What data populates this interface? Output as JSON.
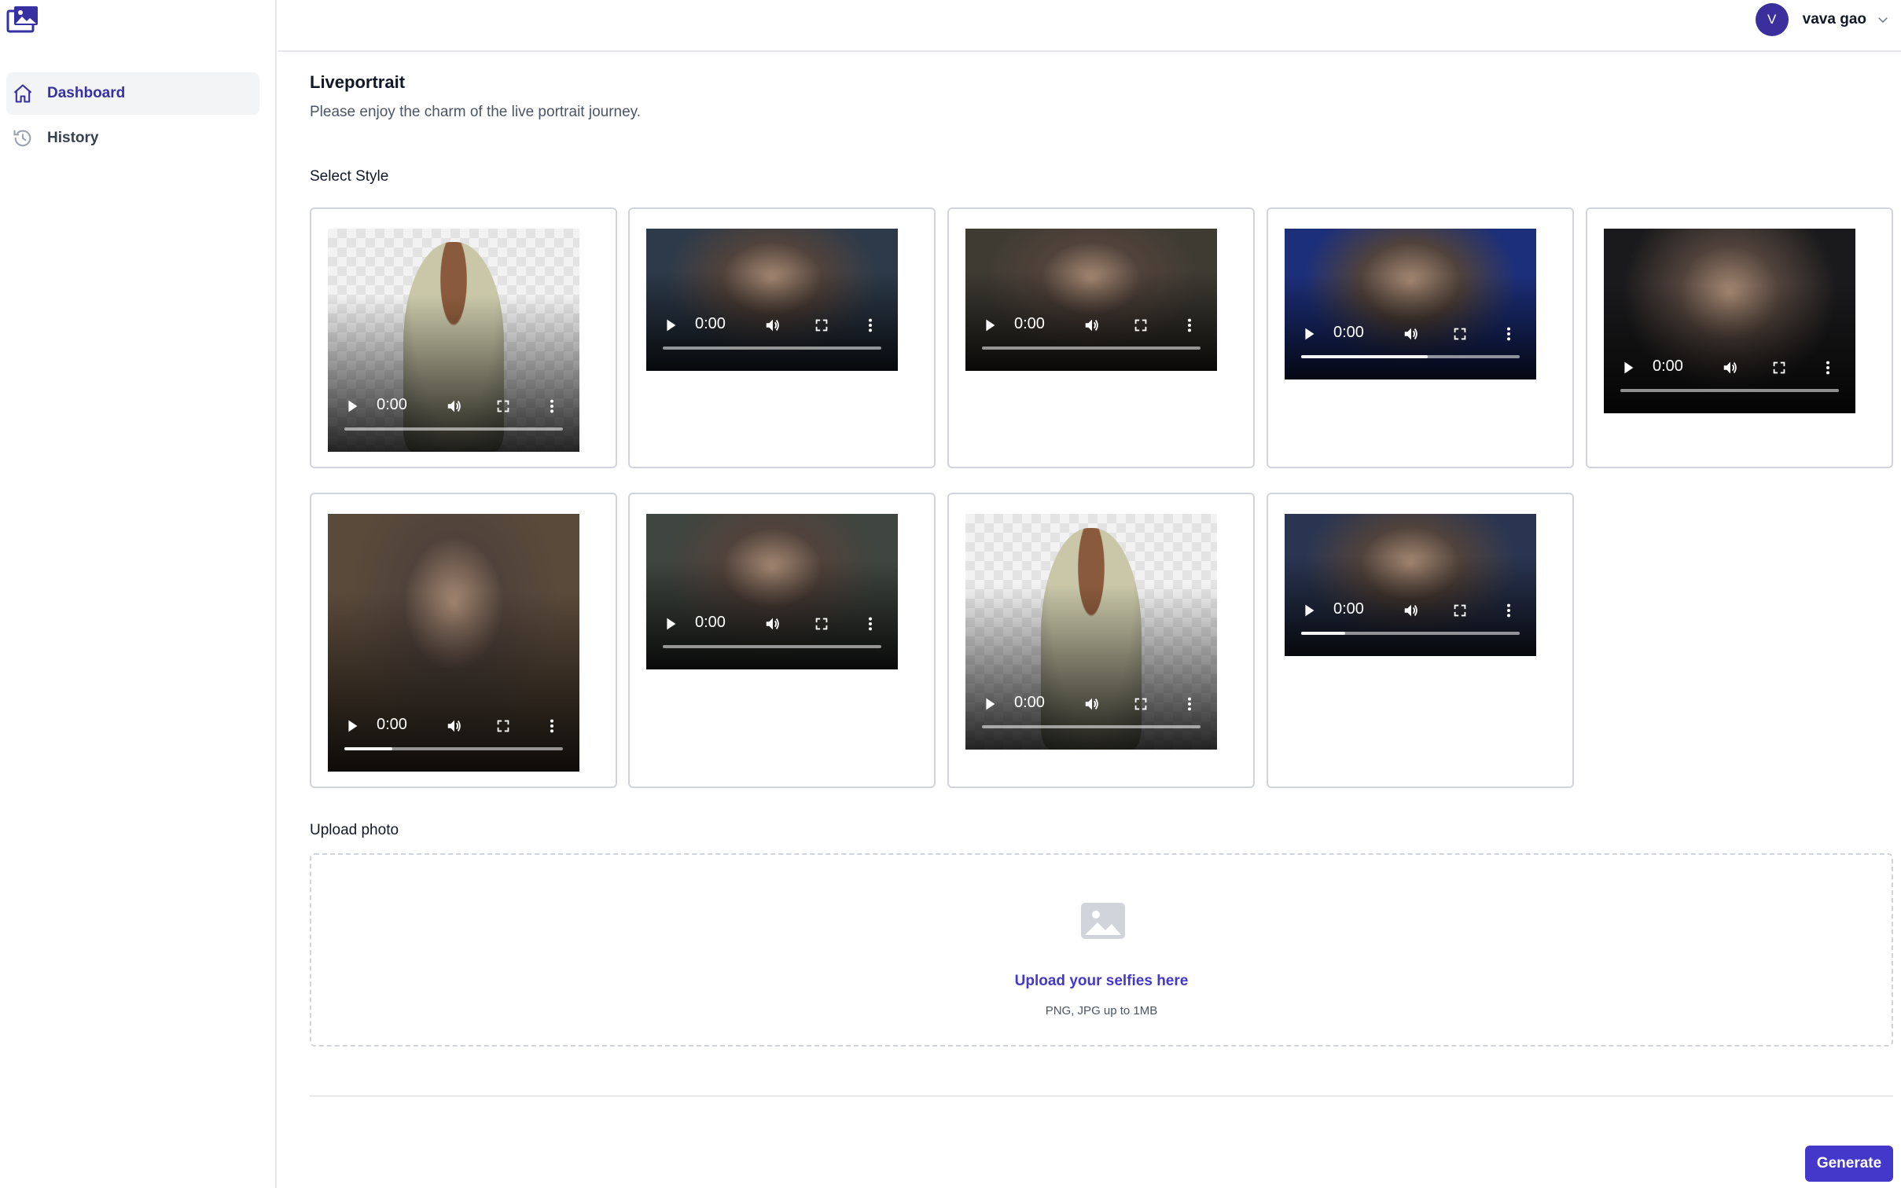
{
  "sidebar": {
    "logo_icon": "image-film-logo-icon",
    "items": [
      {
        "label": "Dashboard",
        "icon": "home-icon",
        "active": true
      },
      {
        "label": "History",
        "icon": "history-clock-icon",
        "active": false
      }
    ]
  },
  "header": {
    "user": {
      "initial": "V",
      "name": "vava gao"
    }
  },
  "main": {
    "title": "Liveportrait",
    "subtitle": "Please enjoy the charm of the live portrait journey.",
    "select_style_label": "Select Style",
    "styles": [
      {
        "time": "0:00",
        "progress": 0.0,
        "bg": "checker"
      },
      {
        "time": "0:00",
        "progress": 0.0,
        "bg": "#2d3a4a"
      },
      {
        "time": "0:00",
        "progress": 0.0,
        "bg": "#3e3b33"
      },
      {
        "time": "0:00",
        "progress": 0.58,
        "bg": "#1c2f7a"
      },
      {
        "time": "0:00",
        "progress": 0.0,
        "bg": "#1a1a1c"
      },
      {
        "time": "0:00",
        "progress": 0.22,
        "bg": "#5a4a3a"
      },
      {
        "time": "0:00",
        "progress": 0.0,
        "bg": "#3f4540"
      },
      {
        "time": "0:00",
        "progress": 0.0,
        "bg": "checker"
      },
      {
        "time": "0:00",
        "progress": 0.2,
        "bg": "#2a3552"
      }
    ],
    "upload_label": "Upload photo",
    "upload": {
      "icon": "image-placeholder-icon",
      "text": "Upload your selfies here",
      "hint": "PNG, JPG up to 1MB"
    },
    "generate_label": "Generate"
  },
  "colors": {
    "accent": "#4338ca",
    "avatar": "#3b2f9e",
    "active_nav_bg": "#f3f4f6"
  }
}
